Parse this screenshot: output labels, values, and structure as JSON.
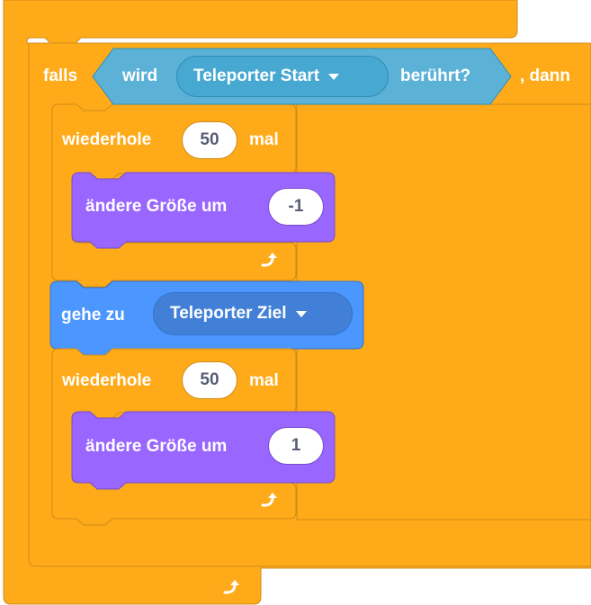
{
  "if_block": {
    "keyword": "falls",
    "then_label": ", dann",
    "condition": {
      "prefix": "wird",
      "target": "Teleporter Start",
      "suffix": "berührt?"
    }
  },
  "repeat_1": {
    "label": "wiederhole",
    "count": "50",
    "times_label": "mal"
  },
  "change_size_1": {
    "label": "ändere Größe um",
    "value": "-1"
  },
  "goto": {
    "label": "gehe zu",
    "target": "Teleporter Ziel"
  },
  "repeat_2": {
    "label": "wiederhole",
    "count": "50",
    "times_label": "mal"
  },
  "change_size_2": {
    "label": "ändere Größe um",
    "value": "1"
  },
  "icons": {
    "loop_arrow": "loop-arrow-icon",
    "dropdown": "dropdown-caret-icon"
  },
  "colors": {
    "control": "#ffab19",
    "control_border": "#cf8b17",
    "sensing": "#5cb1d6",
    "sensing_dark": "#47a8d1",
    "sensing_border": "#2e8eb8",
    "motion": "#4c97ff",
    "motion_dark": "#4280d7",
    "looks": "#9966ff",
    "looks_border": "#774dcb"
  }
}
